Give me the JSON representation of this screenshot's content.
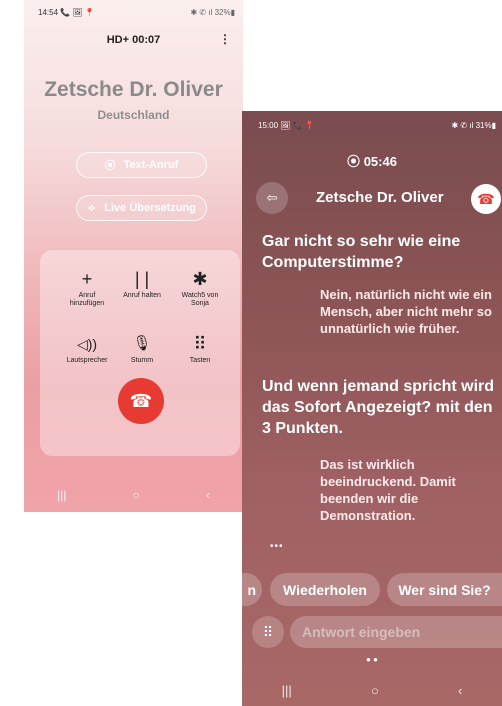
{
  "screen1": {
    "status": {
      "time": "14:54 📞 🖼 📍",
      "right": "✱ ✆ ıl 32%▮"
    },
    "call_timer": "00:07",
    "timer_prefix": "HD+",
    "menu_icon": "⋮",
    "caller_name": "Zetsche Dr. Oliver",
    "caller_location": "Deutschland",
    "text_call_label": "Text-Anruf",
    "live_translate_label": "Live Übersetzung",
    "buttons": [
      {
        "label": "Anruf\nhinzufügen",
        "icon": "+"
      },
      {
        "label": "Anruf halten",
        "icon": "| |"
      },
      {
        "label": "Watch5 von\nSonja",
        "icon": "✱"
      },
      {
        "label": "Lautsprecher",
        "icon": "◁))"
      },
      {
        "label": "Stumm",
        "icon": "🎙"
      },
      {
        "label": "Tasten",
        "icon": "⠿"
      }
    ],
    "nav": {
      "recent": "|||",
      "home": "○",
      "back": "‹"
    }
  },
  "screen2": {
    "status": {
      "time": "15:00 🖼 📞 📍",
      "right": "✱ ✆ ıl 31%▮"
    },
    "call_timer": "05:46",
    "caller_name": "Zetsche Dr. Oliver",
    "messages": [
      {
        "side": "left",
        "text": "Gar nicht so sehr wie eine Computerstimme?"
      },
      {
        "side": "right",
        "text": "Nein, natürlich nicht wie ein Mensch, aber nicht mehr so unnatürlich wie früher."
      },
      {
        "side": "left",
        "text": "Und wenn jemand spricht wird das Sofort Angezeigt? mit den 3 Punkten."
      },
      {
        "side": "right",
        "text": "Das ist wirklich beeindruckend. Damit beenden wir die Demonstration."
      }
    ],
    "typing": "•••",
    "suggestions": [
      "n",
      "Wiederholen",
      "Wer sind Sie?"
    ],
    "input_placeholder": "Antwort eingeben",
    "pager": "● ●",
    "nav": {
      "recent": "|||",
      "home": "○",
      "back": "‹"
    }
  },
  "colors": {
    "hangup": "#e63a32",
    "screen2_bg": "#8d5556",
    "screen1_bg": "#efb6b9"
  }
}
